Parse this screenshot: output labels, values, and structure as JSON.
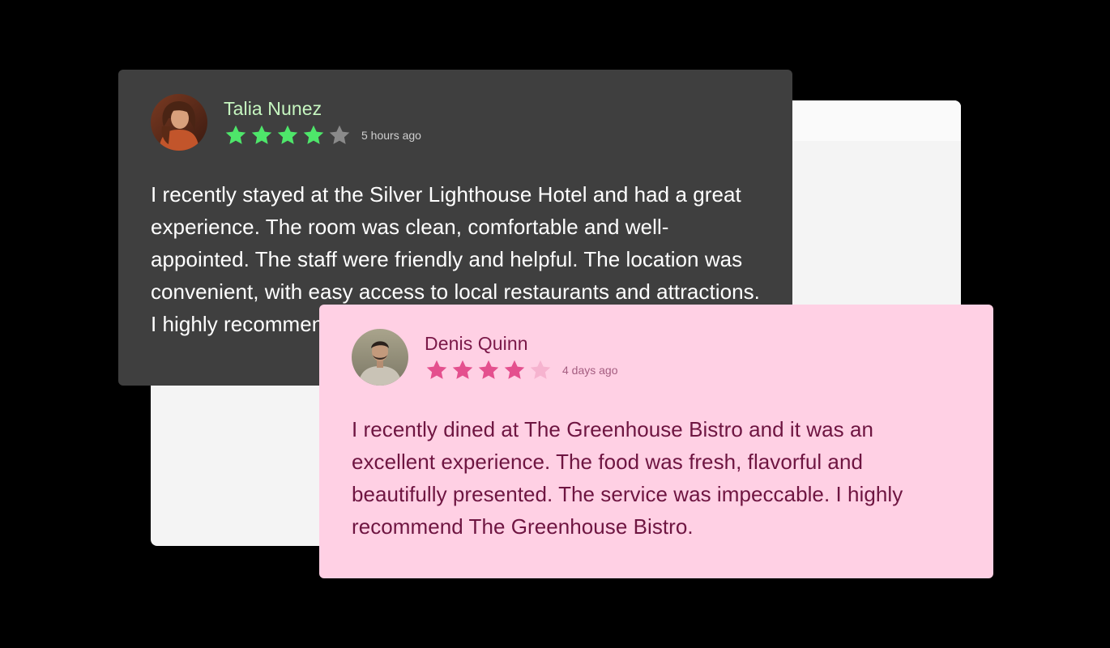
{
  "reviews": [
    {
      "name": "Talia Nunez",
      "rating": 4,
      "max_rating": 5,
      "time": "5 hours ago",
      "text": "I recently stayed at the Silver Lighthouse Hotel and had a great experience. The room was clean, comfortable and well-appointed. The staff were friendly and helpful. The location was convenient, with easy access to local restaurants and attractions. I highly recommend staying at this hotel again in",
      "card_color": "#3f3f3f",
      "star_color": "#4ee66a",
      "star_empty_color": "#8a8a8a"
    },
    {
      "name": "Denis Quinn",
      "rating": 4,
      "max_rating": 5,
      "time": "4 days ago",
      "text": "I recently dined at The Greenhouse Bistro and it was an excellent experience. The food was fresh, flavorful and beautifully presented. The service was impeccable. I highly recommend The Greenhouse Bistro.",
      "card_color": "#ffd0e4",
      "star_color": "#e4508e",
      "star_empty_color": "#f6b3cf"
    }
  ],
  "icons": {
    "avatar_1": "avatar-photo-woman",
    "avatar_2": "avatar-photo-man",
    "star": "star-icon"
  }
}
